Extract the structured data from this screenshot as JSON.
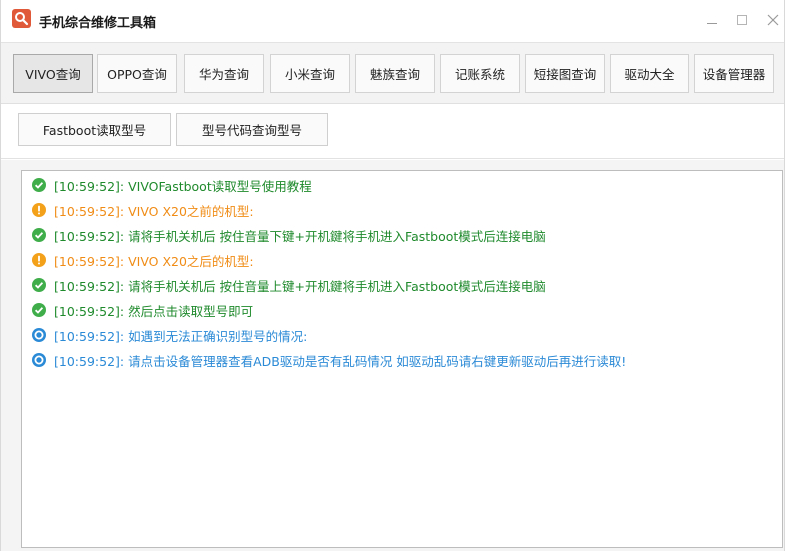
{
  "window": {
    "title": "手机综合维修工具箱"
  },
  "tabs": [
    {
      "label": "VIVO查询",
      "active": true
    },
    {
      "label": "OPPO查询",
      "active": false
    },
    {
      "label": "华为查询",
      "active": false
    },
    {
      "label": "小米查询",
      "active": false
    },
    {
      "label": "魅族查询",
      "active": false
    },
    {
      "label": "记账系统",
      "active": false
    },
    {
      "label": "短接图查询",
      "active": false
    },
    {
      "label": "驱动大全",
      "active": false
    },
    {
      "label": "设备管理器",
      "active": false
    }
  ],
  "actions": {
    "fastboot_read": "Fastboot读取型号",
    "code_lookup": "型号代码查询型号"
  },
  "log": [
    {
      "type": "success",
      "text": "[10:59:52]: VIVOFastboot读取型号使用教程"
    },
    {
      "type": "warning",
      "text": "[10:59:52]: VIVO X20之前的机型:"
    },
    {
      "type": "success",
      "text": "[10:59:52]: 请将手机关机后 按住音量下键+开机鍵将手机进入Fastboot模式后连接电脑"
    },
    {
      "type": "warning",
      "text": "[10:59:52]: VIVO X20之后的机型:"
    },
    {
      "type": "success",
      "text": "[10:59:52]: 请将手机关机后 按住音量上键+开机鍵将手机进入Fastboot模式后连接电脑"
    },
    {
      "type": "success",
      "text": "[10:59:52]: 然后点击读取型号即可"
    },
    {
      "type": "info",
      "text": "[10:59:52]: 如遇到无法正确识别型号的情况:"
    },
    {
      "type": "info",
      "text": "[10:59:52]: 请点击设备管理器查看ADB驱动是否有乱码情况 如驱动乱码请右键更新驱动后再进行读取!"
    }
  ],
  "colors": {
    "success": "#3fae4a",
    "warning": "#f3a01b",
    "info": "#2b8ad6",
    "app_icon": "#e05a3a"
  }
}
